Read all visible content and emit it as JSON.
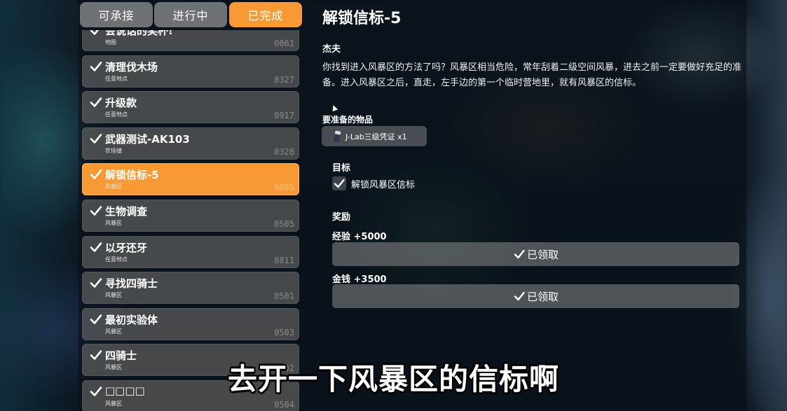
{
  "tabs": [
    {
      "label": "可承接"
    },
    {
      "label": "进行中"
    },
    {
      "label": "已完成"
    }
  ],
  "active_tab": 2,
  "quests": [
    {
      "title": "会说话的奖杯!",
      "location": "地图",
      "number": "0061"
    },
    {
      "title": "清理伐木场",
      "location": "任意地点",
      "number": "0327"
    },
    {
      "title": "升级款",
      "location": "任意地点",
      "number": "0917"
    },
    {
      "title": "武器测试-AK103",
      "location": "农场镇",
      "number": "0328"
    },
    {
      "title": "解锁信标-5",
      "location": "风暴区",
      "number": "0805"
    },
    {
      "title": "生物调查",
      "location": "风暴区",
      "number": "0505"
    },
    {
      "title": "以牙还牙",
      "location": "任意地点",
      "number": "0811"
    },
    {
      "title": "寻找四骑士",
      "location": "风暴区",
      "number": "0501"
    },
    {
      "title": "最初实验体",
      "location": "风暴区",
      "number": "0503"
    },
    {
      "title": "四骑士",
      "location": "风暴区",
      "number": "0502"
    },
    {
      "title": "□□□□",
      "location": "风暴区",
      "number": "0504"
    }
  ],
  "selected_quest": 4,
  "detail": {
    "title": "解锁信标-5",
    "npc": "杰夫",
    "description": "你找到进入风暴区的方法了吗？风暴区相当危险，常年刮着二级空间风暴，进去之前一定要做好充足的准备。进入风暴区之后，直走，左手边的第一个临时营地里，就有风暴区的信标。",
    "required_items_label": "要准备的物品",
    "required_item": "J-Lab三级凭证 x1",
    "objective_label": "目标",
    "objective": "解锁风暴区信标",
    "reward_label": "奖励",
    "rewards": [
      {
        "name": "经验 +5000",
        "button": "已领取"
      },
      {
        "name": "金钱 +3500",
        "button": "已领取"
      }
    ]
  },
  "subtitle": "去开一下风暴区的信标啊",
  "colors": {
    "accent": "#f79a35",
    "tab_inactive": "#6e7274"
  },
  "icons": [
    "check-icon",
    "item-icon"
  ]
}
